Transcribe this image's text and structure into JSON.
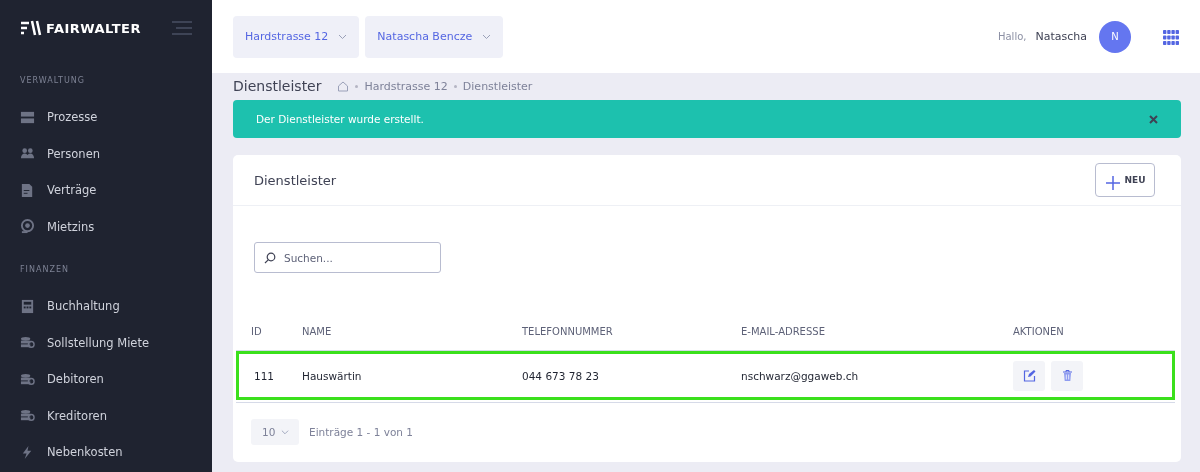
{
  "sidebar": {
    "logo": "FAIRWALTER",
    "sections": [
      {
        "title": "VERWALTUNG",
        "items": [
          {
            "label": "Prozesse",
            "kind": "server"
          },
          {
            "label": "Personen",
            "kind": "people"
          },
          {
            "label": "Verträge",
            "kind": "document"
          },
          {
            "label": "Mietzins",
            "kind": "coin"
          }
        ]
      },
      {
        "title": "FINANZEN",
        "items": [
          {
            "label": "Buchhaltung",
            "kind": "calculator"
          },
          {
            "label": "Sollstellung Miete",
            "kind": "stack"
          },
          {
            "label": "Debitoren",
            "kind": "stack"
          },
          {
            "label": "Kreditoren",
            "kind": "stack"
          },
          {
            "label": "Nebenkosten",
            "kind": "bolt"
          }
        ]
      }
    ]
  },
  "header": {
    "selectors": [
      "Hardstrasse 12",
      "Natascha Bencze"
    ],
    "greeting": "Hallo,",
    "user_name": "Natascha",
    "avatar": "N"
  },
  "page": {
    "title": "Dienstleister",
    "breadcrumb": [
      "Hardstrasse 12",
      "Dienstleister"
    ]
  },
  "alert": {
    "message": "Der Dienstleister wurde erstellt."
  },
  "card": {
    "title": "Dienstleister",
    "new_button": "NEU",
    "search": {
      "placeholder": "Suchen..."
    },
    "table": {
      "columns": [
        "ID",
        "NAME",
        "TELEFONNUMMER",
        "E-MAIL-ADRESSE",
        "AKTIONEN"
      ],
      "rows": [
        {
          "cells": [
            "111",
            "Hauswärtin",
            "044 673 78 23",
            "nschwarz@ggaweb.ch"
          ],
          "highlighted": true
        }
      ]
    },
    "pagination": {
      "page_size": "10",
      "summary": "Einträge 1 - 1 von 1"
    }
  }
}
